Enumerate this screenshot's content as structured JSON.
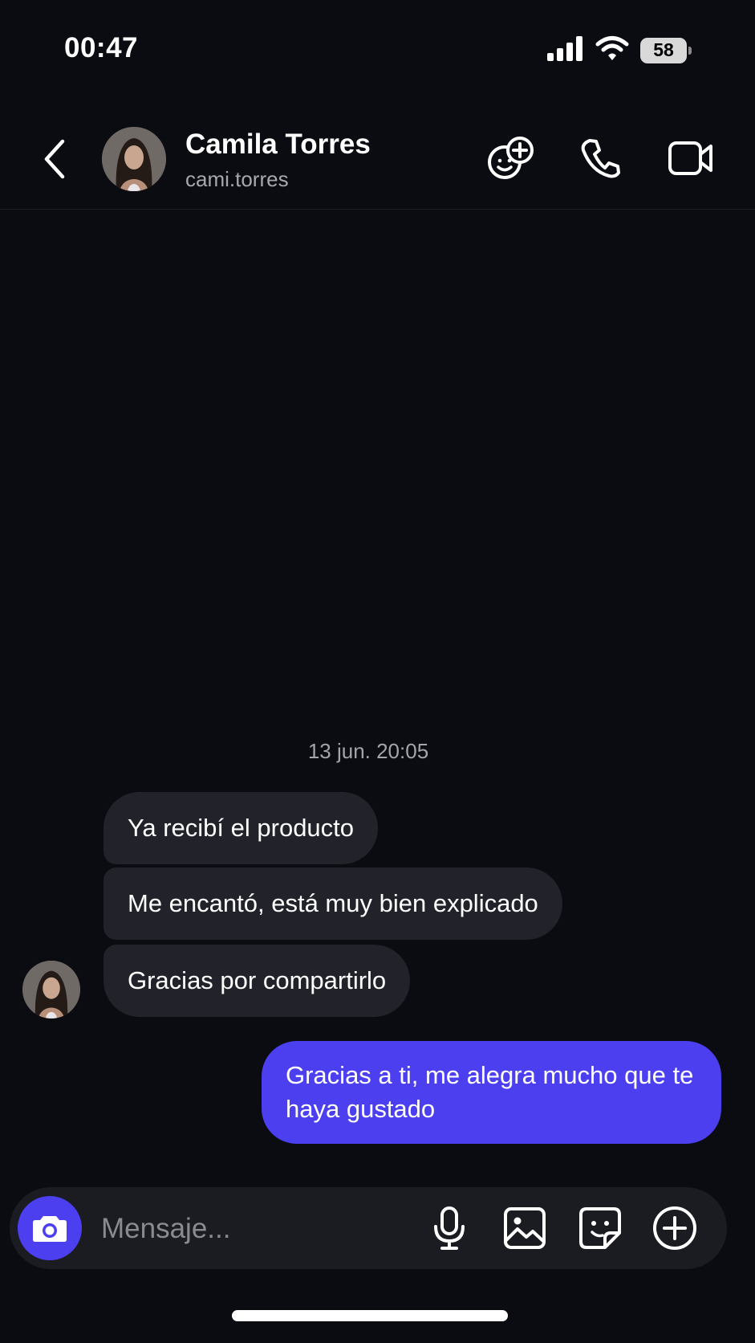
{
  "status_bar": {
    "time": "00:47",
    "battery": "58"
  },
  "header": {
    "contact_name": "Camila Torres",
    "contact_username": "cami.torres",
    "icons": {
      "back": "chevron-left-icon",
      "add_to_chat": "add-people-icon",
      "call": "phone-icon",
      "video": "video-camera-icon"
    }
  },
  "conversation": {
    "timestamp": "13 jun. 20:05",
    "received": [
      "Ya recibí el producto",
      "Me encantó, está muy bien explicado",
      "Gracias por compartirlo"
    ],
    "sent": [
      "Gracias a ti, me alegra mucho que te haya gustado"
    ]
  },
  "composer": {
    "placeholder": "Mensaje...",
    "value": ""
  },
  "colors": {
    "background": "#0b0c11",
    "received_bubble": "#22232a",
    "sent_bubble": "#4c3ff0",
    "accent": "#4c3ff0",
    "secondary_text": "#a7a8ad"
  }
}
